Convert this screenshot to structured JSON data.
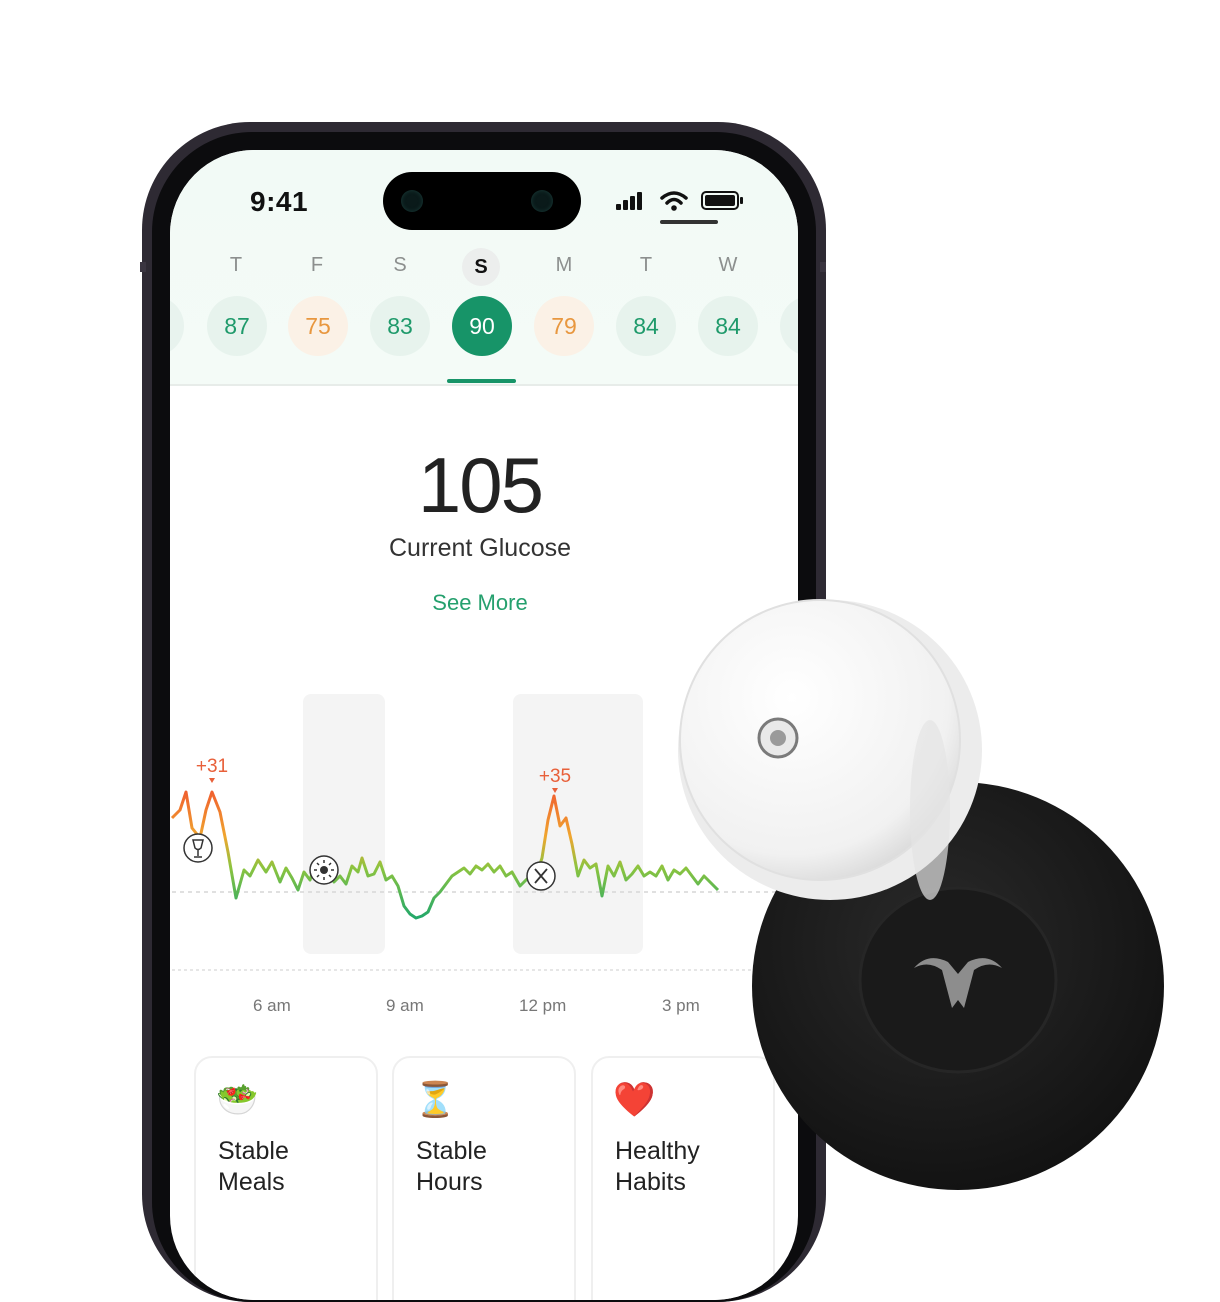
{
  "status_bar": {
    "time": "9:41"
  },
  "week": {
    "days": [
      {
        "letter": "T",
        "score": "87",
        "tone": "green",
        "selected": false
      },
      {
        "letter": "F",
        "score": "75",
        "tone": "orange",
        "selected": false
      },
      {
        "letter": "S",
        "score": "83",
        "tone": "green",
        "selected": false
      },
      {
        "letter": "S",
        "score": "90",
        "tone": "green",
        "selected": true
      },
      {
        "letter": "M",
        "score": "79",
        "tone": "orange",
        "selected": false
      },
      {
        "letter": "T",
        "score": "84",
        "tone": "green",
        "selected": false
      },
      {
        "letter": "W",
        "score": "84",
        "tone": "green",
        "selected": false
      }
    ]
  },
  "glucose": {
    "value": "105",
    "label": "Current Glucose",
    "see_more": "See More"
  },
  "chart_data": {
    "type": "line",
    "x_ticks": [
      "6 am",
      "9 am",
      "12 pm",
      "3 pm"
    ],
    "annotations": [
      "+31",
      "+35"
    ],
    "event_icons": [
      "wine-glass-icon",
      "sun-icon",
      "fork-knife-icon"
    ]
  },
  "cards": [
    {
      "line1": "Stable",
      "line2": "Meals",
      "icon": "🥗"
    },
    {
      "line1": "Stable",
      "line2": "Hours",
      "icon": "⏳"
    },
    {
      "line1": "Healthy",
      "line2": "Habits",
      "icon": "❤️"
    }
  ],
  "colors": {
    "accent_green": "#179468",
    "spike_orange": "#f0602f",
    "score_orange": "#e8973f"
  }
}
